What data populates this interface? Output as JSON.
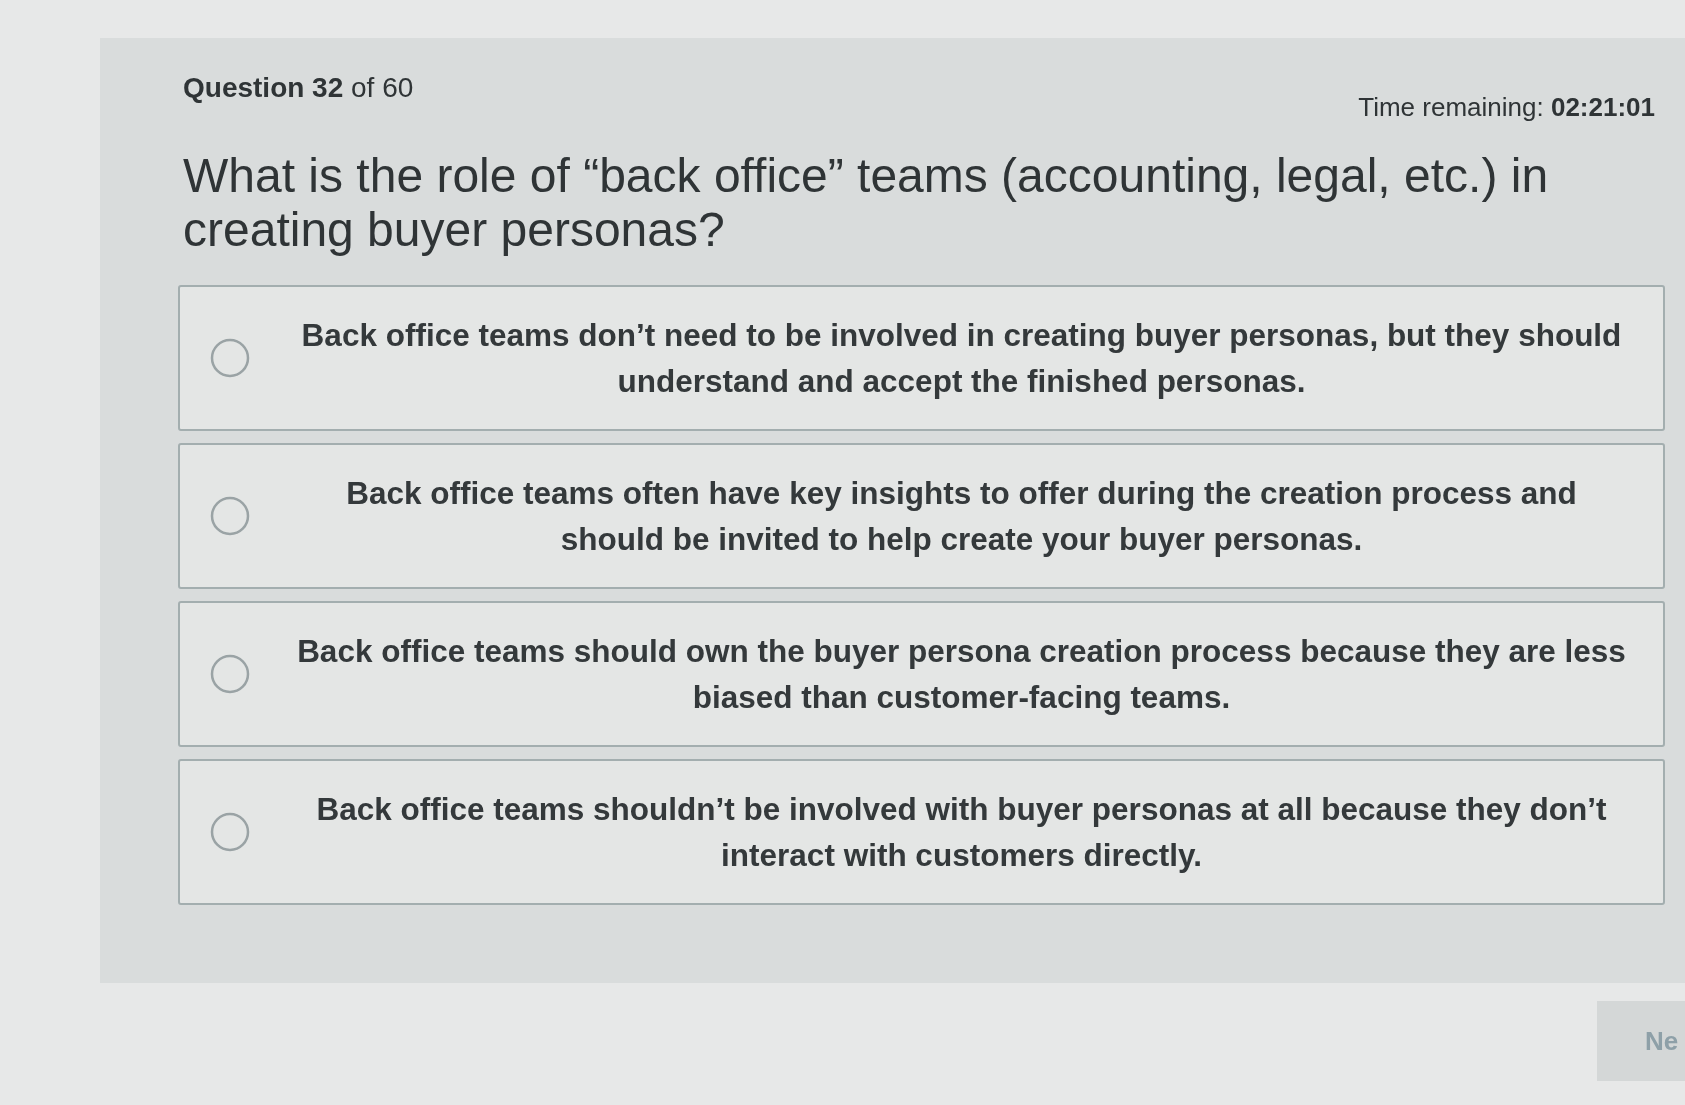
{
  "header": {
    "question_counter": "**Question 32** of 60",
    "time_remaining": "Time remaining: **02:21:01**"
  },
  "question": "What is the role of “back office” teams (accounting, legal, etc.) in creating buyer personas?",
  "options": [
    {
      "text": "Back office teams don’t need to be involved in creating buyer personas, but they should understand and accept the finished personas.",
      "selected": false
    },
    {
      "text": "Back office teams often have key insights to offer during the creation process and should be invited to help create your buyer personas.",
      "selected": false
    },
    {
      "text": "Back office teams should own the buyer persona creation process because they are less biased than customer-facing teams.",
      "selected": false
    },
    {
      "text": "Back office teams shouldn’t be involved with buyer personas at all because they don’t interact with customers directly.",
      "selected": false
    }
  ],
  "next_button": "Ne"
}
